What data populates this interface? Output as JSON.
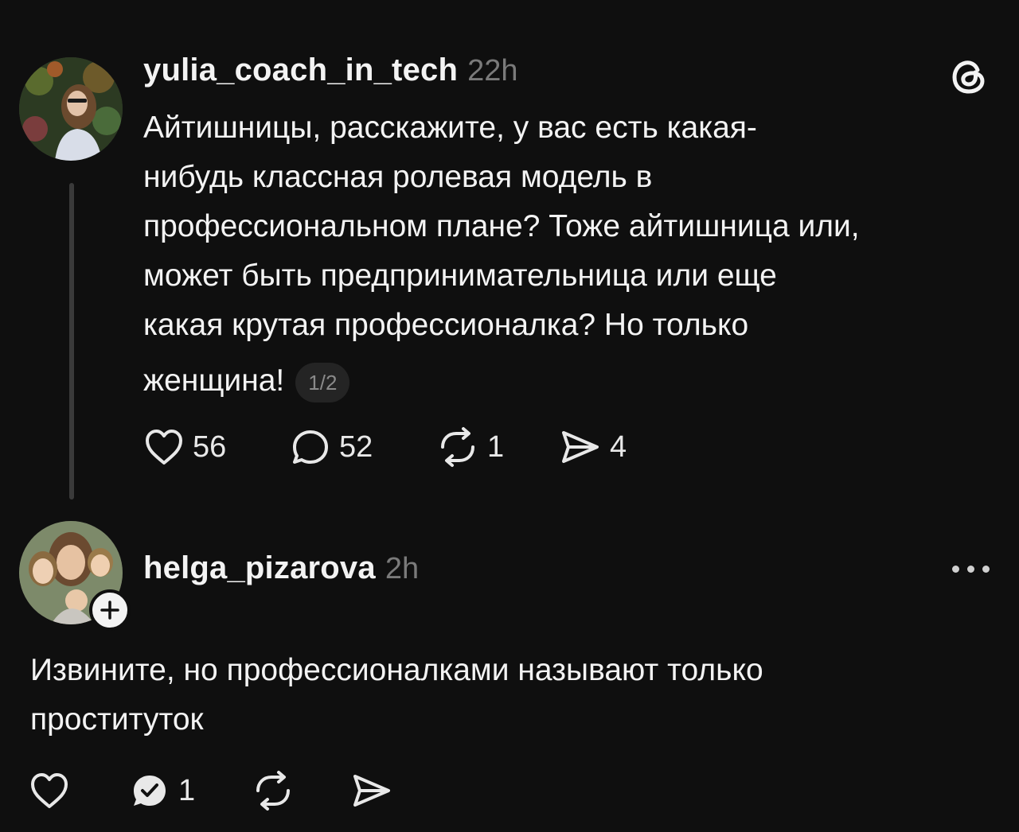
{
  "post": {
    "username": "yulia_coach_in_tech",
    "time": "22h",
    "text_lines": [
      "Айтишницы, расскажите, у вас есть какая-",
      "нибудь классная ролевая модель в",
      "профессиональном плане? Тоже айтишница или,",
      "может быть предпринимательница или еще",
      "какая крутая профессионалка? Но только",
      "женщина!"
    ],
    "page_indicator": "1/2",
    "likes": "56",
    "replies": "52",
    "reposts": "1",
    "shares": "4",
    "avatar_icon": "profile-photo",
    "brand_icon": "threads-logo-icon"
  },
  "reply": {
    "username": "helga_pizarova",
    "time": "2h",
    "text_lines": [
      "Извините, но профессионалками называют только",
      "проституток"
    ],
    "replies": "1",
    "avatar_icon": "profile-photo",
    "follow_icon": "plus-icon",
    "menu_icon": "more-options-icon"
  }
}
